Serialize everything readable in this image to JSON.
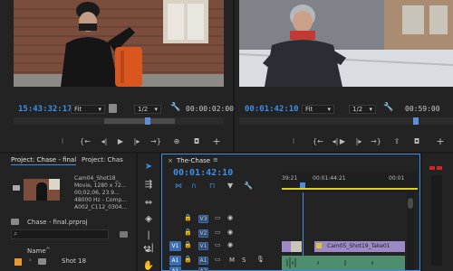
{
  "source_monitor": {
    "timecode": "15:43:32:17",
    "fit": "Fit",
    "quality": "1/2",
    "duration": "00:00:02:00"
  },
  "program_monitor": {
    "timecode": "00:01:42:10",
    "fit": "Fit",
    "quality": "1/2",
    "duration": "00:59:00"
  },
  "project_panel": {
    "tab_active": "Project: Chase - final",
    "tab_other": "Project: Chas",
    "clip_info": [
      "Cam04_Shot18_",
      "Movie, 1280 x 72...",
      "00;02;06, 23.9...",
      "48000 Hz - Comp...",
      "A002_C112_0304..."
    ],
    "project_file": "Chase - final.prproj",
    "column_name": "Name",
    "bin_item": "Shot 18"
  },
  "timeline": {
    "sequence_name": "The-Chase",
    "timecode": "00:01:42:10",
    "ruler": [
      "39:21",
      "00:01:44:21",
      "00:01"
    ],
    "tracks": [
      {
        "src": "",
        "label": "V3"
      },
      {
        "src": "",
        "label": "V2"
      },
      {
        "src": "V1",
        "label": "V1"
      },
      {
        "src": "A1",
        "label": "A1",
        "m": "M",
        "s": "S"
      },
      {
        "src": "A1",
        "label": "A2"
      }
    ],
    "clip_label": "Cam05_Shot19_Take01"
  },
  "colors": {
    "accent_blue": "#3b8fe8",
    "playhead": "#4f8fe0",
    "clip_video": "#9c89c6",
    "clip_audio": "#4e8d6e",
    "work_area": "#d9d21e"
  }
}
